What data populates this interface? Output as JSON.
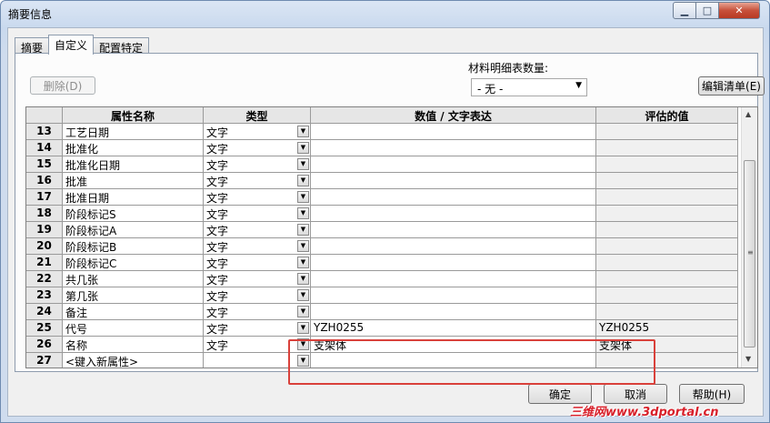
{
  "window": {
    "title": "摘要信息"
  },
  "tabs": [
    {
      "label": "摘要"
    },
    {
      "label": "自定义"
    },
    {
      "label": "配置特定"
    }
  ],
  "toolbar": {
    "delete_label": "删除(D)",
    "bom_quantity_label": "材料明细表数量:",
    "bom_quantity_value": "- 无 -",
    "edit_list_label": "编辑清单(E)"
  },
  "grid": {
    "columns": [
      "属性名称",
      "类型",
      "数值 / 文字表达",
      "评估的值"
    ],
    "rows": [
      {
        "num": "13",
        "name": "工艺日期",
        "type": "文字",
        "value": "",
        "evaluated": ""
      },
      {
        "num": "14",
        "name": "批准化",
        "type": "文字",
        "value": "",
        "evaluated": ""
      },
      {
        "num": "15",
        "name": "批准化日期",
        "type": "文字",
        "value": "",
        "evaluated": ""
      },
      {
        "num": "16",
        "name": "批准",
        "type": "文字",
        "value": "",
        "evaluated": ""
      },
      {
        "num": "17",
        "name": "批准日期",
        "type": "文字",
        "value": "",
        "evaluated": ""
      },
      {
        "num": "18",
        "name": "阶段标记S",
        "type": "文字",
        "value": "",
        "evaluated": ""
      },
      {
        "num": "19",
        "name": "阶段标记A",
        "type": "文字",
        "value": "",
        "evaluated": ""
      },
      {
        "num": "20",
        "name": "阶段标记B",
        "type": "文字",
        "value": "",
        "evaluated": ""
      },
      {
        "num": "21",
        "name": "阶段标记C",
        "type": "文字",
        "value": "",
        "evaluated": ""
      },
      {
        "num": "22",
        "name": "共几张",
        "type": "文字",
        "value": "",
        "evaluated": ""
      },
      {
        "num": "23",
        "name": "第几张",
        "type": "文字",
        "value": "",
        "evaluated": ""
      },
      {
        "num": "24",
        "name": "备注",
        "type": "文字",
        "value": "",
        "evaluated": ""
      },
      {
        "num": "25",
        "name": "代号",
        "type": "文字",
        "value": "YZH0255",
        "evaluated": "YZH0255"
      },
      {
        "num": "26",
        "name": "名称",
        "type": "文字",
        "value": "支架体",
        "evaluated": "支架体"
      },
      {
        "num": "27",
        "name": "<键入新属性>",
        "type": "",
        "value": "",
        "evaluated": ""
      }
    ]
  },
  "buttons": {
    "ok_label": "确定",
    "cancel_label": "取消",
    "help_label": "帮助(H)"
  },
  "watermark": "三维网www.3dportal.cn",
  "colors": {
    "highlight": "#d9413b",
    "close_button": "#c7503a",
    "watermark": "#d8202a"
  }
}
